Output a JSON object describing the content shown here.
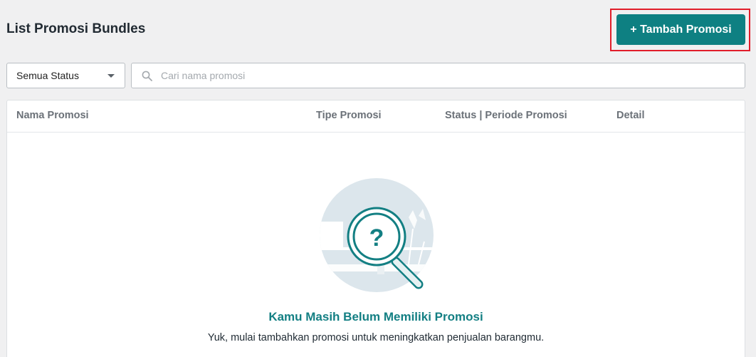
{
  "header": {
    "title": "List Promosi Bundles",
    "add_button_label": "+ Tambah Promosi"
  },
  "filters": {
    "status_selected": "Semua Status",
    "search_placeholder": "Cari nama promosi",
    "search_value": ""
  },
  "table": {
    "columns": [
      "Nama Promosi",
      "Tipe Promosi",
      "Status | Periode Promosi",
      "Detail"
    ]
  },
  "empty_state": {
    "title": "Kamu Masih Belum Memiliki Promosi",
    "subtitle": "Yuk, mulai tambahkan promosi untuk meningkatkan penjualan barangmu.",
    "icon": "magnifier-question-icon"
  },
  "colors": {
    "accent": "#0e8082",
    "highlight": "#e11d2a",
    "empty_title": "#137f83"
  }
}
